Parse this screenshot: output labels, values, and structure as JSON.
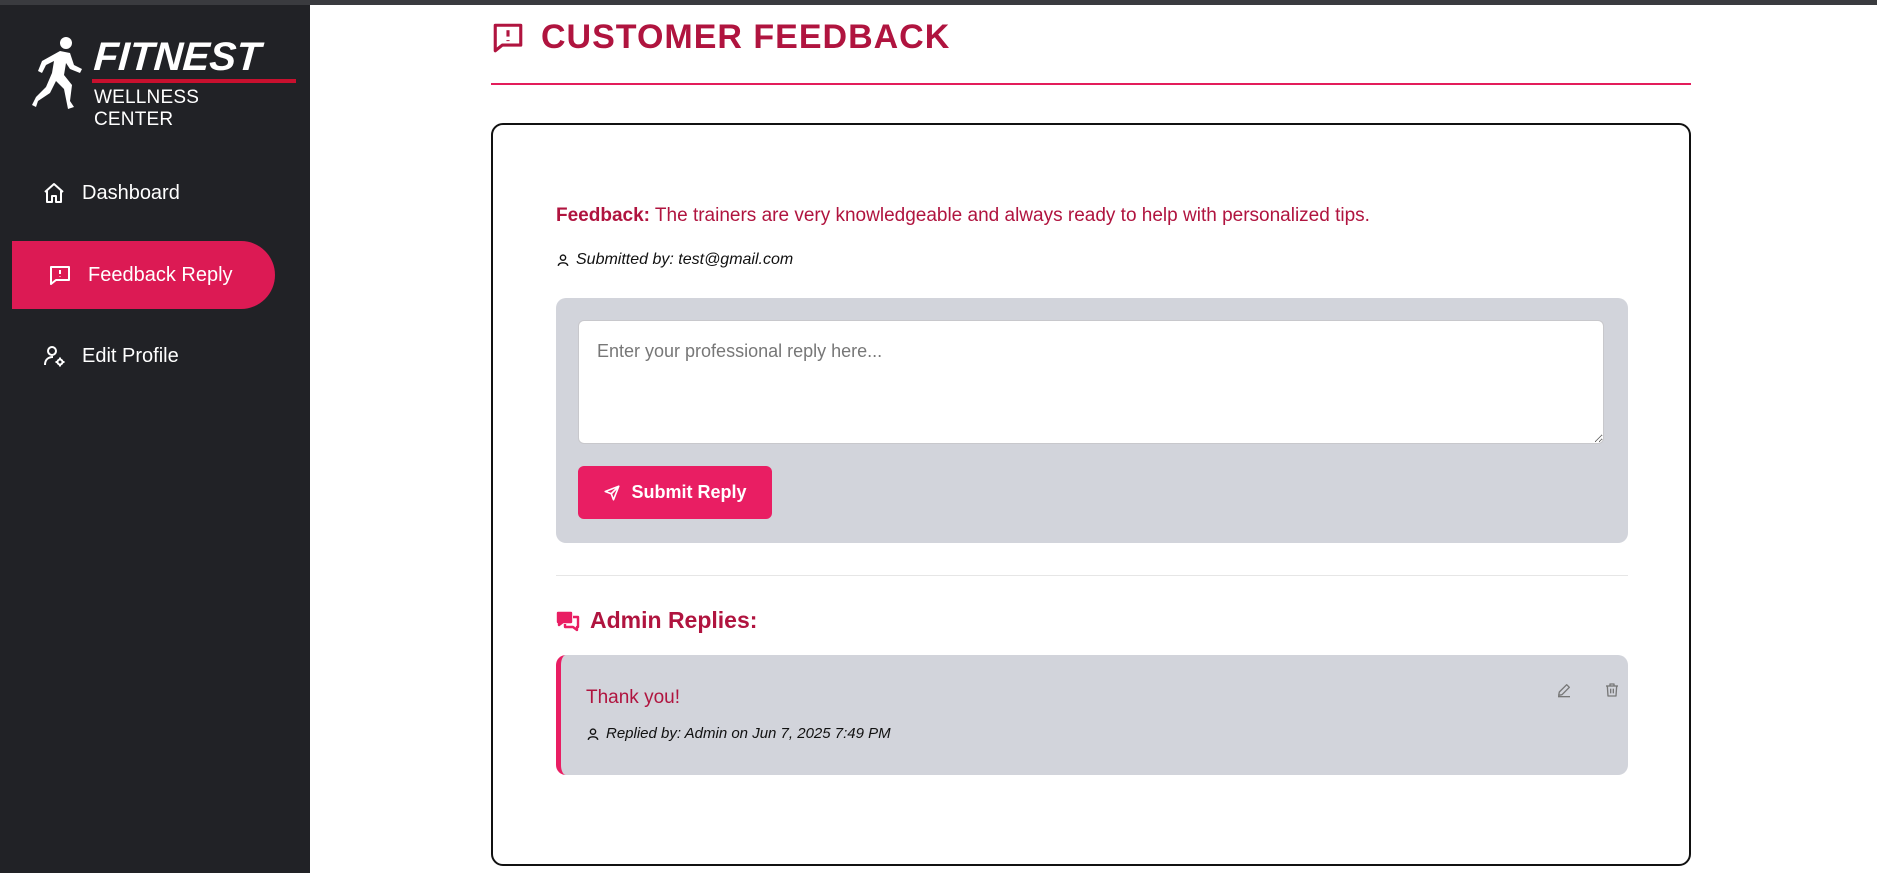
{
  "brand": {
    "name": "FITNEST",
    "subtitle": "WELLNESS CENTER"
  },
  "sidebar": {
    "items": [
      {
        "label": "Dashboard",
        "icon": "home-icon",
        "active": false
      },
      {
        "label": "Feedback Reply",
        "icon": "feedback-icon",
        "active": true
      },
      {
        "label": "Edit Profile",
        "icon": "user-gear-icon",
        "active": false
      }
    ]
  },
  "page": {
    "title": "CUSTOMER FEEDBACK",
    "title_icon": "feedback-icon"
  },
  "feedback": {
    "label": "Feedback:",
    "text": "The trainers are very knowledgeable and always ready to help with personalized tips.",
    "submitted_by": "Submitted by: test@gmail.com"
  },
  "reply_form": {
    "placeholder": "Enter your professional reply here...",
    "value": "",
    "submit_label": "Submit Reply"
  },
  "replies": {
    "title": "Admin Replies:",
    "items": [
      {
        "text": "Thank you!",
        "meta": "Replied by: Admin on Jun 7, 2025 7:49 PM"
      }
    ]
  },
  "colors": {
    "accent": "#e91e63",
    "accent_dark": "#b0143f",
    "sidebar_bg": "#212226",
    "panel_bg": "#d2d4db"
  }
}
